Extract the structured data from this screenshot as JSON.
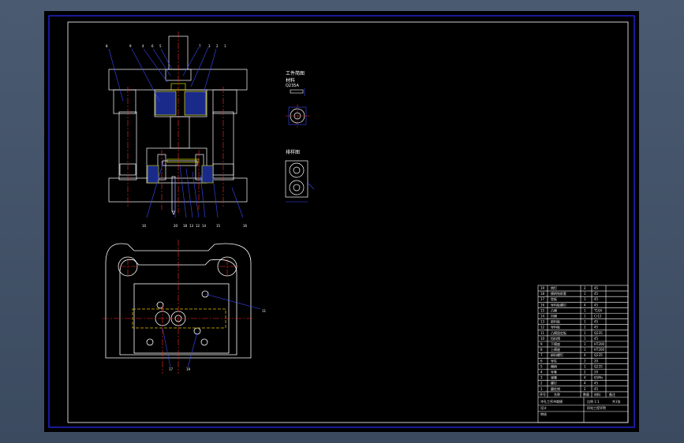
{
  "colors": {
    "frame": "#2a2aff",
    "outline": "#ffffff",
    "centerline": "#ff2a2a",
    "leader": "#3a4aff",
    "section": "#ffff00",
    "hidden": "#e6c000"
  },
  "part_drawing": {
    "title": "工件简图",
    "material_label": "材料",
    "material_value": "Q235A"
  },
  "layout_drawing": {
    "title": "排样图"
  },
  "front_view": {
    "top_callouts": [
      "8",
      "9",
      "4",
      "6",
      "5",
      "7",
      "3",
      "2",
      "1"
    ],
    "bottom_callouts": [
      "10",
      "20",
      "18",
      "13",
      "12",
      "14",
      "15",
      "16"
    ]
  },
  "plan_view": {
    "callouts": [
      "11",
      "17",
      "19"
    ]
  },
  "title_block": {
    "rows": [
      {
        "no": "19",
        "name": "销钉",
        "qty": "2",
        "mat": "45"
      },
      {
        "no": "18",
        "name": "模柄铣削套",
        "qty": "1",
        "mat": "45"
      },
      {
        "no": "17",
        "name": "垫板",
        "qty": "1",
        "mat": "45"
      },
      {
        "no": "16",
        "name": "导料板螺钉",
        "qty": "4",
        "mat": "45"
      },
      {
        "no": "15",
        "name": "凸模",
        "qty": "1",
        "mat": "T10A"
      },
      {
        "no": "14",
        "name": "凹模",
        "qty": "1",
        "mat": "Cr12"
      },
      {
        "no": "13",
        "name": "卸料板",
        "qty": "1",
        "mat": "45"
      },
      {
        "no": "12",
        "name": "导料板",
        "qty": "2",
        "mat": "45"
      },
      {
        "no": "11",
        "name": "凸模固定板",
        "qty": "1",
        "mat": "Q235"
      },
      {
        "no": "10",
        "name": "挡料销",
        "qty": "1",
        "mat": "45"
      },
      {
        "no": "9",
        "name": "下模座",
        "qty": "1",
        "mat": "HT200"
      },
      {
        "no": "8",
        "name": "上模座",
        "qty": "1",
        "mat": "HT200"
      },
      {
        "no": "7",
        "name": "卸料螺钉",
        "qty": "4",
        "mat": "Q235"
      },
      {
        "no": "6",
        "name": "导柱",
        "qty": "2",
        "mat": "20"
      },
      {
        "no": "5",
        "name": "模柄",
        "qty": "1",
        "mat": "Q235"
      },
      {
        "no": "4",
        "name": "导套",
        "qty": "2",
        "mat": "20"
      },
      {
        "no": "3",
        "name": "弹簧",
        "qty": "4",
        "mat": "65Mn"
      },
      {
        "no": "2",
        "name": "螺钉",
        "qty": "4",
        "mat": "45"
      },
      {
        "no": "1",
        "name": "圆柱销",
        "qty": "2",
        "mat": "45"
      }
    ],
    "header": {
      "no": "序号",
      "name": "名称",
      "qty": "数量",
      "mat": "材料",
      "remark": "备注"
    },
    "drawing_title": "冲孔工序冲裁模",
    "scale_label": "比例",
    "scale_value": "1:1",
    "sheet_label": "共1张",
    "unit": "机电工程学院",
    "designer_label": "设计",
    "checker_label": "审核"
  }
}
